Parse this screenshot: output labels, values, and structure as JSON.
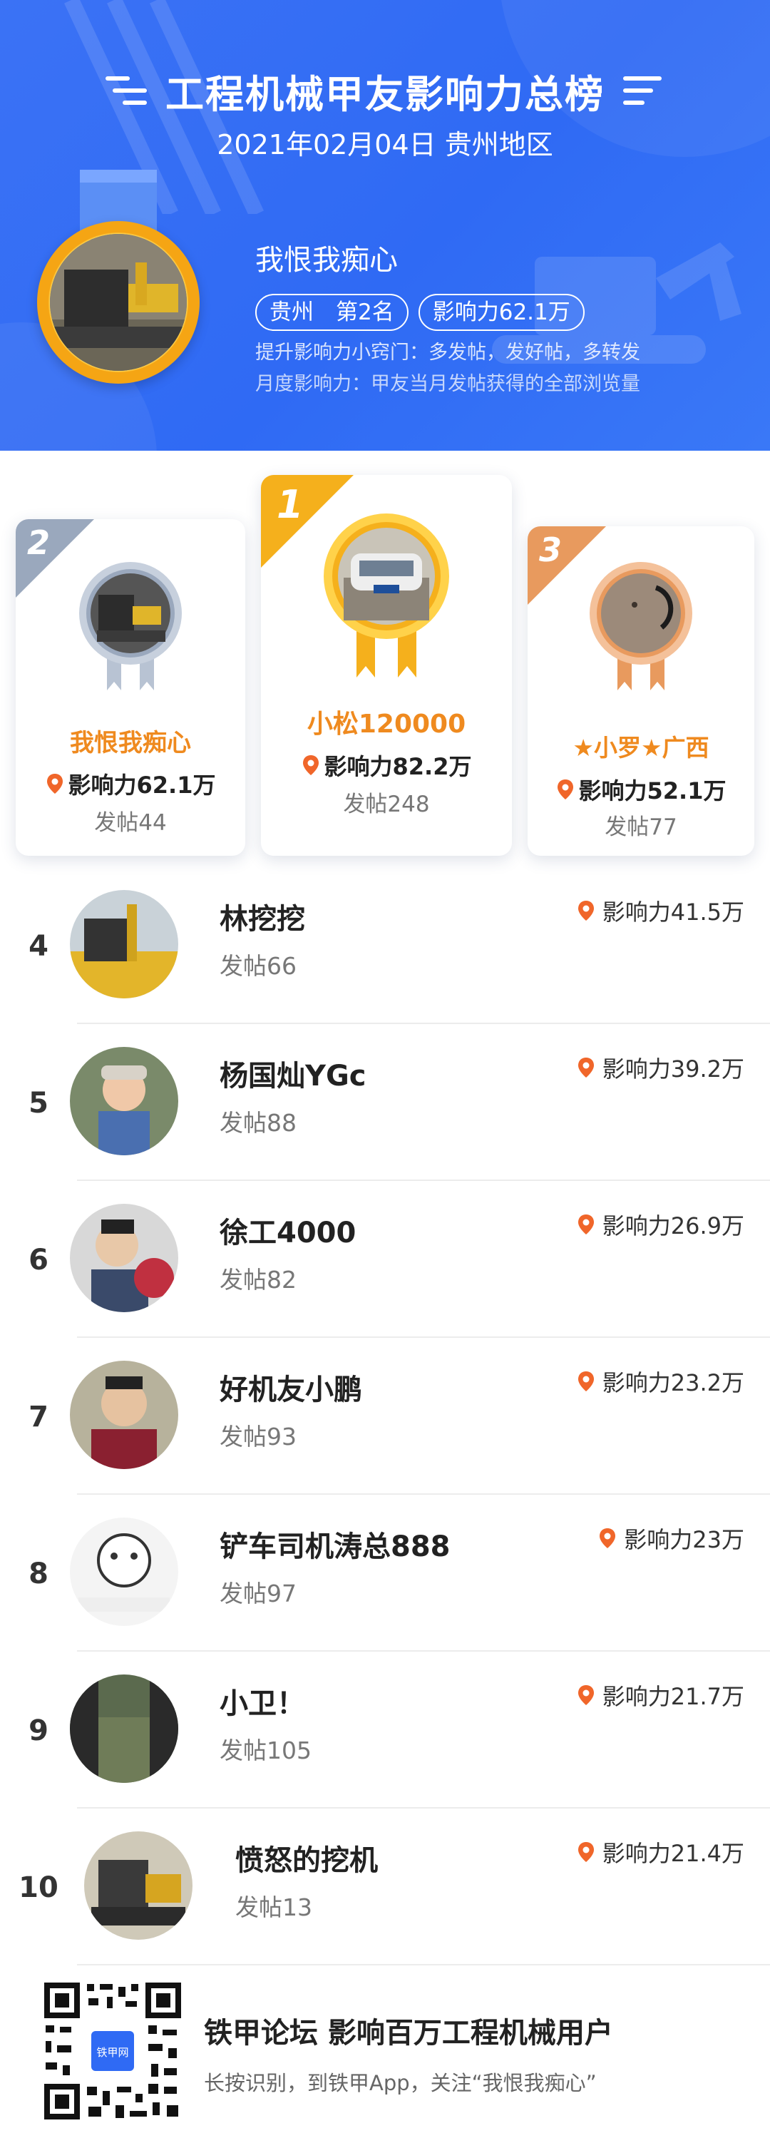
{
  "header": {
    "title": "工程机械甲友影响力总榜",
    "subtitle": "2021年02月04日 贵州地区"
  },
  "me": {
    "name": "我恨我痴心",
    "region_rank": "贵州　第2名",
    "influence": "影响力62.1万",
    "tip": "提升影响力小窍门：多发帖，发好帖，多转发",
    "definition": "月度影响力：甲友当月发帖获得的全部浏览量"
  },
  "podium": [
    {
      "rank": "2",
      "name": "我恨我痴心",
      "influence": "影响力62.1万",
      "posts": "发帖44"
    },
    {
      "rank": "1",
      "name": "小松120000",
      "influence": "影响力82.2万",
      "posts": "发帖248"
    },
    {
      "rank": "3",
      "name": "★小罗★广西",
      "influence": "影响力52.1万",
      "posts": "发帖77"
    }
  ],
  "list": [
    {
      "rank": "4",
      "name": "林挖挖",
      "posts": "发帖66",
      "influence": "影响力41.5万"
    },
    {
      "rank": "5",
      "name": "杨国灿YGc",
      "posts": "发帖88",
      "influence": "影响力39.2万"
    },
    {
      "rank": "6",
      "name": "徐工4000",
      "posts": "发帖82",
      "influence": "影响力26.9万"
    },
    {
      "rank": "7",
      "name": "好机友小鹏",
      "posts": "发帖93",
      "influence": "影响力23.2万"
    },
    {
      "rank": "8",
      "name": "铲车司机涛总888",
      "posts": "发帖97",
      "influence": "影响力23万"
    },
    {
      "rank": "9",
      "name": "小卫！",
      "posts": "发帖105",
      "influence": "影响力21.7万"
    },
    {
      "rank": "10",
      "name": "愤怒的挖机",
      "posts": "发帖13",
      "influence": "影响力21.4万"
    }
  ],
  "footer": {
    "title": "铁甲论坛 影响百万工程机械用户",
    "subtitle": "长按识别，到铁甲App，关注“我恨我痴心”",
    "qr_logo": "铁甲网"
  },
  "colors": {
    "header_blue": "#3270f4",
    "gold": "#f5b01c",
    "silver": "#9aa8bd",
    "bronze": "#e89a5e",
    "name_orange": "#ef8a1f",
    "pin_orange": "#f0662a"
  }
}
